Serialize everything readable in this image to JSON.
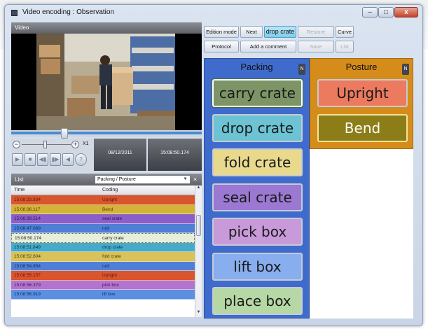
{
  "window": {
    "title": "Video encoding : Observation",
    "minimize_glyph": "–",
    "maximize_glyph": "□",
    "close_glyph": "x"
  },
  "video": {
    "header": "Video",
    "zoom_minus": "−",
    "zoom_plus": "+",
    "zoom_label": "X1",
    "date": "08/12/2011",
    "time": "15:08:50.174",
    "position": 0.28
  },
  "toolbar": {
    "edition_mode": "Edition mode",
    "next": "Next",
    "current_code": "drop crate",
    "restore": "Restore",
    "curve": "Curve",
    "protocol": "Protocol",
    "add_comment": "Add a comment",
    "save": "Save",
    "list": "List"
  },
  "list": {
    "header": "List",
    "filter": "Packing / Posture",
    "close": "×",
    "columns": [
      "Time",
      "Coding"
    ],
    "rows": [
      {
        "time": "15:08:33.834",
        "coding": "Upright",
        "color": "#d9552e",
        "text": "#5a1a08"
      },
      {
        "time": "15:08:36.117",
        "coding": "Bend",
        "color": "#d4b437",
        "text": "#4a3c05"
      },
      {
        "time": "15:08:39.514",
        "coding": "seal crate",
        "color": "#8b5fc9",
        "text": "#2c1552"
      },
      {
        "time": "15:08:47.669",
        "coding": "null",
        "color": "#4f7fd6",
        "text": "#10295c"
      },
      {
        "time": "15:08:50.174",
        "coding": "carry crate",
        "color": "#e8efd8",
        "text": "#222222"
      },
      {
        "time": "15:08:51.849",
        "coding": "drop crate",
        "color": "#47aac6",
        "text": "#0a3644"
      },
      {
        "time": "15:08:52.604",
        "coding": "fold crate",
        "color": "#d9c258",
        "text": "#4a3c05"
      },
      {
        "time": "15:08:54.854",
        "coding": "null",
        "color": "#4f7fd6",
        "text": "#10295c"
      },
      {
        "time": "15:08:55.157",
        "coding": "Upright",
        "color": "#d9552e",
        "text": "#5a1a08"
      },
      {
        "time": "15:08:56.379",
        "coding": "pick box",
        "color": "#b374d0",
        "text": "#3a1256"
      },
      {
        "time": "15:08:56.919",
        "coding": "lift box",
        "color": "#5b8fe0",
        "text": "#10295c"
      }
    ]
  },
  "packing": {
    "title": "Packing",
    "badge": "N",
    "buttons": [
      {
        "label": "carry crate",
        "color": "#7d9566",
        "active": true
      },
      {
        "label": "drop crate",
        "color": "#6cc3d4",
        "active": false
      },
      {
        "label": "fold crate",
        "color": "#e9d98d",
        "active": false
      },
      {
        "label": "seal crate",
        "color": "#9b78d1",
        "active": false
      },
      {
        "label": "pick box",
        "color": "#c89ad9",
        "active": false
      },
      {
        "label": "lift box",
        "color": "#88aef0",
        "active": false
      },
      {
        "label": "place box",
        "color": "#b5d8a5",
        "active": false
      }
    ]
  },
  "posture": {
    "title": "Posture",
    "badge": "N",
    "buttons": [
      {
        "label": "Upright",
        "color": "#ec7a5e"
      },
      {
        "label": "Bend",
        "color": "#8c7d18"
      }
    ]
  }
}
